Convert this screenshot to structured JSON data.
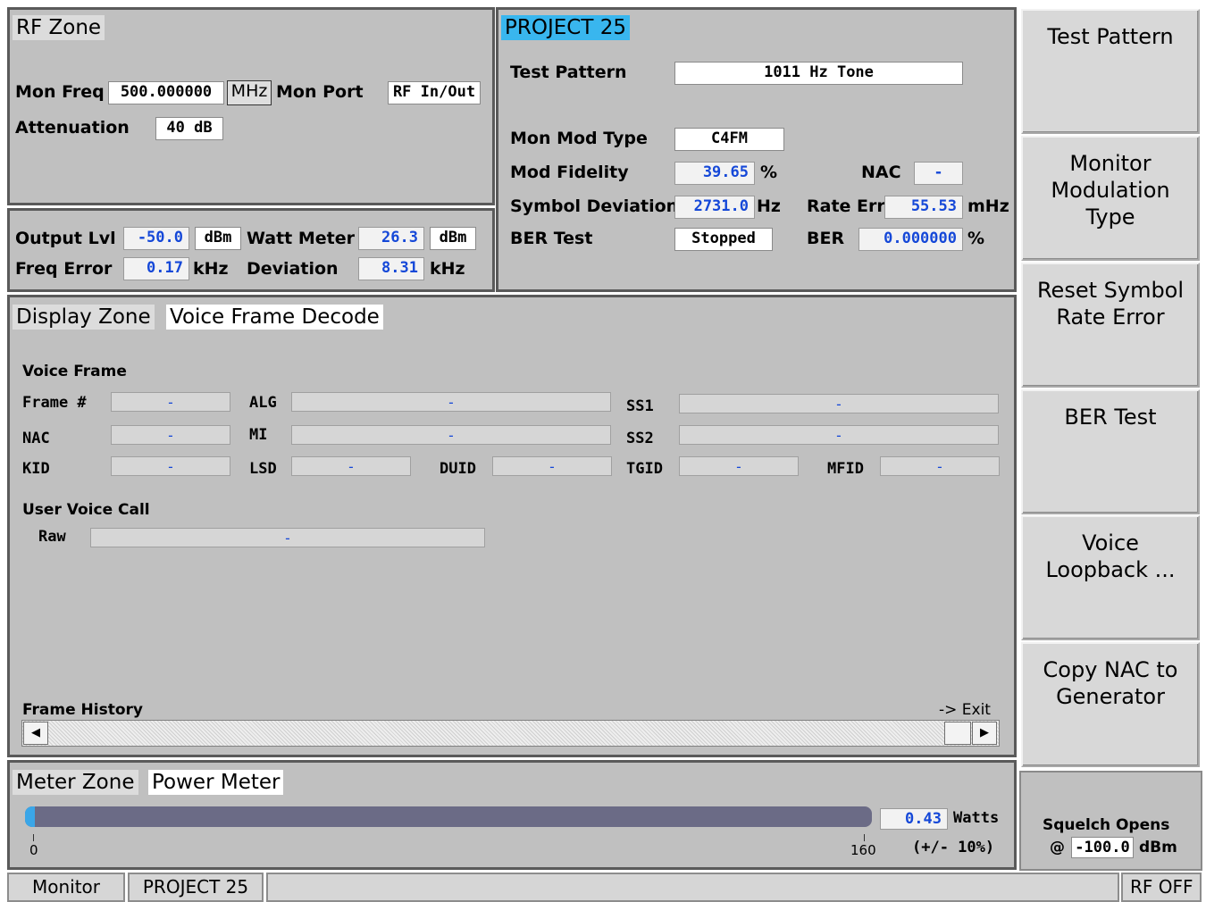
{
  "rf_zone": {
    "title": "RF Zone",
    "mon_freq_label": "Mon Freq",
    "mon_freq_value": "500.000000",
    "mon_freq_unit": "MHz",
    "mon_port_label": "Mon Port",
    "mon_port_value": "RF In/Out",
    "attenuation_label": "Attenuation",
    "attenuation_value": "40 dB",
    "output_lvl_label": "Output Lvl",
    "output_lvl_value": "-50.0",
    "output_lvl_unit": "dBm",
    "watt_meter_label": "Watt Meter",
    "watt_meter_value": "26.3",
    "watt_meter_unit": "dBm",
    "freq_error_label": "Freq Error",
    "freq_error_value": "0.17",
    "freq_error_unit": "kHz",
    "deviation_label": "Deviation",
    "deviation_value": "8.31",
    "deviation_unit": "kHz"
  },
  "p25": {
    "title": "PROJECT 25",
    "test_pattern_label": "Test Pattern",
    "test_pattern_value": "1011 Hz Tone",
    "mon_mod_type_label": "Mon Mod Type",
    "mon_mod_type_value": "C4FM",
    "mod_fidelity_label": "Mod Fidelity",
    "mod_fidelity_value": "39.65",
    "mod_fidelity_unit": "%",
    "nac_label": "NAC",
    "nac_value": "-",
    "symbol_dev_label": "Symbol Deviation",
    "symbol_dev_value": "2731.0",
    "symbol_dev_unit": "Hz",
    "rate_err_label": "Rate Err",
    "rate_err_value": "55.53",
    "rate_err_unit": "mHz",
    "ber_test_label": "BER Test",
    "ber_test_value": "Stopped",
    "ber_label": "BER",
    "ber_value": "0.000000",
    "ber_unit": "%"
  },
  "display_zone": {
    "title": "Display Zone",
    "subtitle": "Voice Frame Decode",
    "voice_frame_heading": "Voice Frame",
    "fields": {
      "frame_label": "Frame #",
      "frame_value": "-",
      "alg_label": "ALG",
      "alg_value": "-",
      "ss1_label": "SS1",
      "ss1_value": "-",
      "nac_label": "NAC",
      "nac_value": "-",
      "mi_label": "MI",
      "mi_value": "-",
      "ss2_label": "SS2",
      "ss2_value": "-",
      "kid_label": "KID",
      "kid_value": "-",
      "lsd_label": "LSD",
      "lsd_value": "-",
      "duid_label": "DUID",
      "duid_value": "-",
      "tgid_label": "TGID",
      "tgid_value": "-",
      "mfid_label": "MFID",
      "mfid_value": "-"
    },
    "user_voice_heading": "User Voice Call",
    "raw_label": "Raw",
    "raw_value": "-",
    "frame_history_label": "Frame History",
    "exit_label": "-> Exit",
    "scroll_left": "◀",
    "scroll_right": "▶"
  },
  "meter_zone": {
    "title": "Meter Zone",
    "subtitle": "Power Meter",
    "value": "0.43",
    "unit": "Watts",
    "accuracy": "(+/- 10%)",
    "scale_min": "0",
    "scale_max": "160",
    "level": 0.0027,
    "bar_color": "#6b6b86",
    "fill_color": "#3aa6e8"
  },
  "softkeys": [
    {
      "lines": [
        "Test Pattern"
      ]
    },
    {
      "lines": [
        "Monitor",
        "Modulation",
        "Type"
      ]
    },
    {
      "lines": [
        "Reset Symbol",
        "Rate Error"
      ]
    },
    {
      "lines": [
        "BER Test"
      ]
    },
    {
      "lines": [
        "Voice",
        "Loopback ..."
      ]
    },
    {
      "lines": [
        "Copy NAC to",
        "Generator"
      ]
    }
  ],
  "squelch": {
    "label": "Squelch Opens",
    "at": "@",
    "value": "-100.0",
    "unit": "dBm"
  },
  "status_bar": {
    "mode": "Monitor",
    "standard": "PROJECT 25",
    "message": "",
    "rf_state": "RF OFF"
  }
}
